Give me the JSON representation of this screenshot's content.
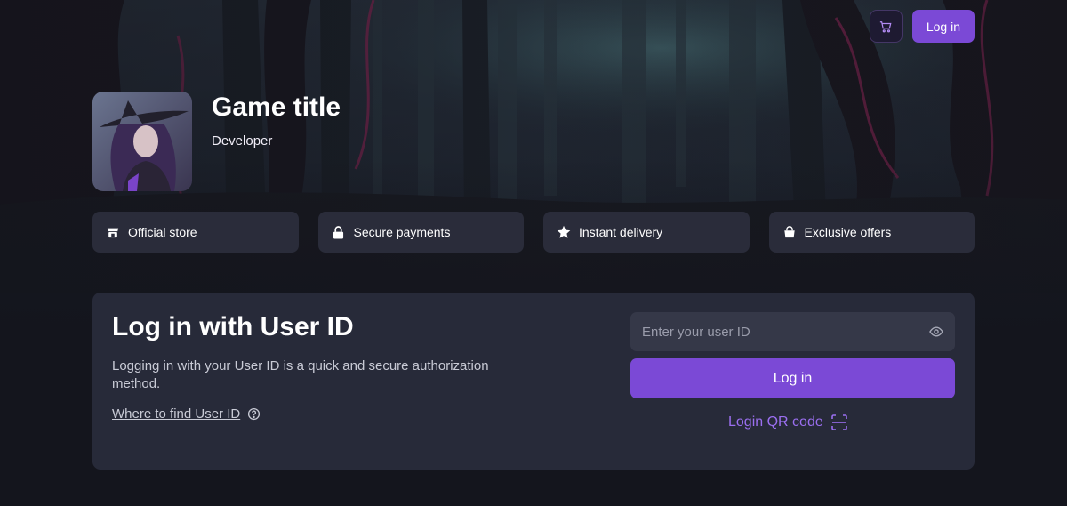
{
  "header": {
    "login_label": "Log in"
  },
  "game": {
    "title": "Game title",
    "developer": "Developer"
  },
  "features": [
    {
      "label": "Official store",
      "icon": "store-icon"
    },
    {
      "label": "Secure payments",
      "icon": "lock-icon"
    },
    {
      "label": "Instant delivery",
      "icon": "star-icon"
    },
    {
      "label": "Exclusive offers",
      "icon": "bag-icon"
    }
  ],
  "login": {
    "title": "Log in with User ID",
    "description": "Logging in with your User ID is a quick and secure authorization method.",
    "help_link": "Where to find User ID",
    "input_placeholder": "Enter your user ID",
    "input_value": "",
    "submit_label": "Log in",
    "qr_label": "Login QR code"
  },
  "colors": {
    "accent": "#7b49d6",
    "accent_text": "#9b6ff0",
    "panel": "#272a39",
    "feature_bg": "#2a2c3a",
    "page_bg": "#14151d"
  }
}
